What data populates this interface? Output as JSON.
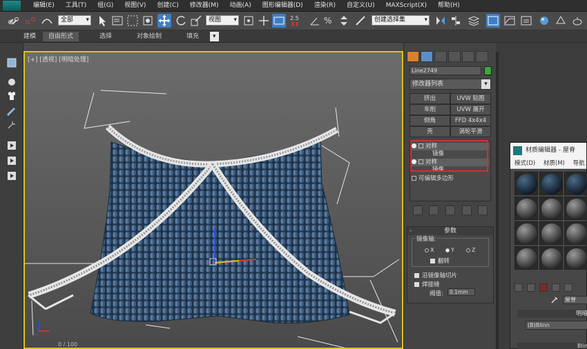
{
  "menu": {
    "items": [
      "编辑(E)",
      "工具(T)",
      "组(G)",
      "视图(V)",
      "创建(C)",
      "修改器(M)",
      "动画(A)",
      "图形编辑器(D)",
      "渲染(R)",
      "自定义(U)",
      "MAXScript(X)",
      "帮助(H)"
    ]
  },
  "toolbar": {
    "selection_filter": "全部",
    "ref_coord": "视图",
    "snap_value": "2.5",
    "named_selection": "创建选择集"
  },
  "ribbon": {
    "tabs": [
      "建模",
      "自由形式",
      "选择",
      "对象绘制",
      "填充"
    ]
  },
  "viewport": {
    "label": "[+] [透视] [明暗处理]",
    "counter": "0 / 100"
  },
  "command_panel": {
    "object_name": "Line2749",
    "modifier_list": "修改器列表",
    "buttons": [
      "挤出",
      "UVW 贴图",
      "车削",
      "UVW 展开",
      "倒角",
      "FFD 4x4x4",
      "壳",
      "涡轮平滑"
    ],
    "stack": [
      {
        "label": "对称",
        "kind": "modifier"
      },
      {
        "label": "镜像",
        "kind": "sub"
      },
      {
        "label": "对称",
        "kind": "modifier"
      },
      {
        "label": "镜像",
        "kind": "sub"
      },
      {
        "label": "可编辑多边形",
        "kind": "base"
      }
    ],
    "params": {
      "title": "参数",
      "mirror_axis": "镜像轴:",
      "axes": [
        "X",
        "Y",
        "Z"
      ],
      "selected_axis": "Y",
      "flip": "翻转",
      "slice": "沿镜像轴切片",
      "weld": "焊接缝",
      "threshold_label": "阈值:",
      "threshold_value": "0.1mm"
    }
  },
  "material_editor": {
    "title": "材质编辑器 - 屋脊",
    "menu": [
      "模式(D)",
      "材质(M)",
      "导航(N"
    ],
    "material_name": "屋脊",
    "rollout_label": "明暗",
    "shader": "(B)Blinn",
    "rollout2_label": "Blin"
  },
  "colors": {
    "viewport_border": "#e0c21a",
    "highlight_box": "#d32f2f",
    "object_color": "#3aa83a",
    "tiles": "#2f4a6b"
  }
}
